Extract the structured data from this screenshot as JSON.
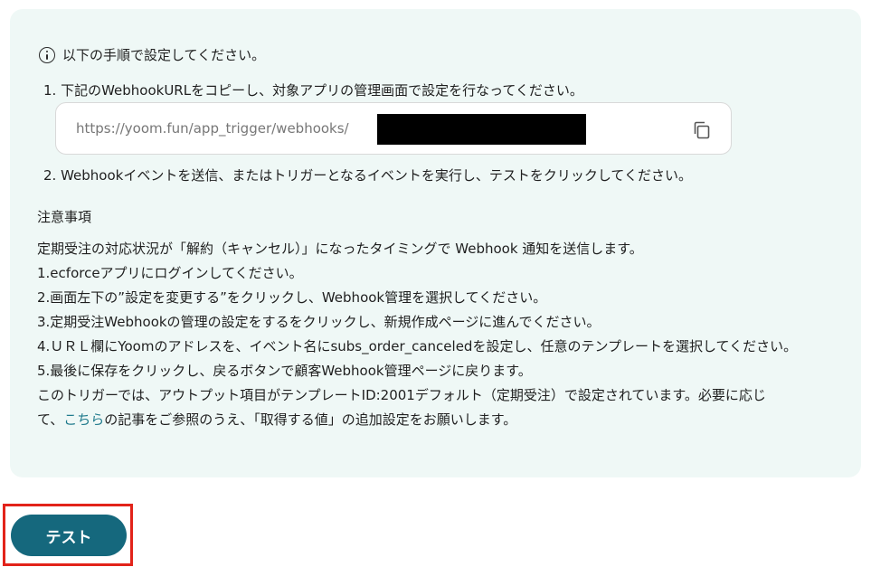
{
  "info": {
    "heading": "以下の手順で設定してください。"
  },
  "steps": {
    "step1": "1. 下記のWebhookURLをコピーし、対象アプリの管理画面で設定を行なってください。",
    "url": "https://yoom.fun/app_trigger/webhooks/",
    "step2": "2. Webhookイベントを送信、またはトリガーとなるイベントを実行し、テストをクリックしてください。"
  },
  "notes": {
    "title": "注意事項",
    "lines": [
      "定期受注の対応状況が「解約（キャンセル）」になったタイミングで Webhook 通知を送信します。",
      "1.ecforceアプリにログインしてください。",
      "2.画面左下の”設定を変更する”をクリックし、Webhook管理を選択してください。",
      "3.定期受注Webhookの管理の設定をするをクリックし、新規作成ページに進んでください。",
      "4.ＵＲＬ欄にYoomのアドレスを、イベント名にsubs_order_canceledを設定し、任意のテンプレートを選択してください。",
      "5.最後に保存をクリックし、戻るボタンで顧客Webhook管理ページに戻ります。",
      "このトリガーでは、アウトプット項目がテンプレートID:2001デフォルト（定期受注）で設定されています。必要に応じ"
    ],
    "last_prefix": "て、",
    "link": "こちら",
    "last_suffix": "の記事をご参照のうえ、「取得する値」の追加設定をお願いします。"
  },
  "button": {
    "label": "テスト"
  },
  "colors": {
    "panel": "#eff8f6",
    "button": "#15687d",
    "link": "#1f7a8c",
    "highlight": "#e2231a"
  }
}
